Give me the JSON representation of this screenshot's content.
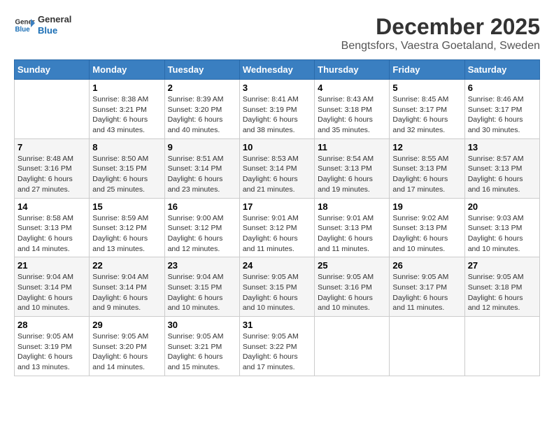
{
  "logo": {
    "line1": "General",
    "line2": "Blue"
  },
  "title": "December 2025",
  "location": "Bengtsfors, Vaestra Goetaland, Sweden",
  "days_header": [
    "Sunday",
    "Monday",
    "Tuesday",
    "Wednesday",
    "Thursday",
    "Friday",
    "Saturday"
  ],
  "weeks": [
    [
      {
        "day": "",
        "sunrise": "",
        "sunset": "",
        "daylight": ""
      },
      {
        "day": "1",
        "sunrise": "Sunrise: 8:38 AM",
        "sunset": "Sunset: 3:21 PM",
        "daylight": "Daylight: 6 hours and 43 minutes."
      },
      {
        "day": "2",
        "sunrise": "Sunrise: 8:39 AM",
        "sunset": "Sunset: 3:20 PM",
        "daylight": "Daylight: 6 hours and 40 minutes."
      },
      {
        "day": "3",
        "sunrise": "Sunrise: 8:41 AM",
        "sunset": "Sunset: 3:19 PM",
        "daylight": "Daylight: 6 hours and 38 minutes."
      },
      {
        "day": "4",
        "sunrise": "Sunrise: 8:43 AM",
        "sunset": "Sunset: 3:18 PM",
        "daylight": "Daylight: 6 hours and 35 minutes."
      },
      {
        "day": "5",
        "sunrise": "Sunrise: 8:45 AM",
        "sunset": "Sunset: 3:17 PM",
        "daylight": "Daylight: 6 hours and 32 minutes."
      },
      {
        "day": "6",
        "sunrise": "Sunrise: 8:46 AM",
        "sunset": "Sunset: 3:17 PM",
        "daylight": "Daylight: 6 hours and 30 minutes."
      }
    ],
    [
      {
        "day": "7",
        "sunrise": "Sunrise: 8:48 AM",
        "sunset": "Sunset: 3:16 PM",
        "daylight": "Daylight: 6 hours and 27 minutes."
      },
      {
        "day": "8",
        "sunrise": "Sunrise: 8:50 AM",
        "sunset": "Sunset: 3:15 PM",
        "daylight": "Daylight: 6 hours and 25 minutes."
      },
      {
        "day": "9",
        "sunrise": "Sunrise: 8:51 AM",
        "sunset": "Sunset: 3:14 PM",
        "daylight": "Daylight: 6 hours and 23 minutes."
      },
      {
        "day": "10",
        "sunrise": "Sunrise: 8:53 AM",
        "sunset": "Sunset: 3:14 PM",
        "daylight": "Daylight: 6 hours and 21 minutes."
      },
      {
        "day": "11",
        "sunrise": "Sunrise: 8:54 AM",
        "sunset": "Sunset: 3:13 PM",
        "daylight": "Daylight: 6 hours and 19 minutes."
      },
      {
        "day": "12",
        "sunrise": "Sunrise: 8:55 AM",
        "sunset": "Sunset: 3:13 PM",
        "daylight": "Daylight: 6 hours and 17 minutes."
      },
      {
        "day": "13",
        "sunrise": "Sunrise: 8:57 AM",
        "sunset": "Sunset: 3:13 PM",
        "daylight": "Daylight: 6 hours and 16 minutes."
      }
    ],
    [
      {
        "day": "14",
        "sunrise": "Sunrise: 8:58 AM",
        "sunset": "Sunset: 3:13 PM",
        "daylight": "Daylight: 6 hours and 14 minutes."
      },
      {
        "day": "15",
        "sunrise": "Sunrise: 8:59 AM",
        "sunset": "Sunset: 3:12 PM",
        "daylight": "Daylight: 6 hours and 13 minutes."
      },
      {
        "day": "16",
        "sunrise": "Sunrise: 9:00 AM",
        "sunset": "Sunset: 3:12 PM",
        "daylight": "Daylight: 6 hours and 12 minutes."
      },
      {
        "day": "17",
        "sunrise": "Sunrise: 9:01 AM",
        "sunset": "Sunset: 3:12 PM",
        "daylight": "Daylight: 6 hours and 11 minutes."
      },
      {
        "day": "18",
        "sunrise": "Sunrise: 9:01 AM",
        "sunset": "Sunset: 3:13 PM",
        "daylight": "Daylight: 6 hours and 11 minutes."
      },
      {
        "day": "19",
        "sunrise": "Sunrise: 9:02 AM",
        "sunset": "Sunset: 3:13 PM",
        "daylight": "Daylight: 6 hours and 10 minutes."
      },
      {
        "day": "20",
        "sunrise": "Sunrise: 9:03 AM",
        "sunset": "Sunset: 3:13 PM",
        "daylight": "Daylight: 6 hours and 10 minutes."
      }
    ],
    [
      {
        "day": "21",
        "sunrise": "Sunrise: 9:04 AM",
        "sunset": "Sunset: 3:14 PM",
        "daylight": "Daylight: 6 hours and 10 minutes."
      },
      {
        "day": "22",
        "sunrise": "Sunrise: 9:04 AM",
        "sunset": "Sunset: 3:14 PM",
        "daylight": "Daylight: 6 hours and 9 minutes."
      },
      {
        "day": "23",
        "sunrise": "Sunrise: 9:04 AM",
        "sunset": "Sunset: 3:15 PM",
        "daylight": "Daylight: 6 hours and 10 minutes."
      },
      {
        "day": "24",
        "sunrise": "Sunrise: 9:05 AM",
        "sunset": "Sunset: 3:15 PM",
        "daylight": "Daylight: 6 hours and 10 minutes."
      },
      {
        "day": "25",
        "sunrise": "Sunrise: 9:05 AM",
        "sunset": "Sunset: 3:16 PM",
        "daylight": "Daylight: 6 hours and 10 minutes."
      },
      {
        "day": "26",
        "sunrise": "Sunrise: 9:05 AM",
        "sunset": "Sunset: 3:17 PM",
        "daylight": "Daylight: 6 hours and 11 minutes."
      },
      {
        "day": "27",
        "sunrise": "Sunrise: 9:05 AM",
        "sunset": "Sunset: 3:18 PM",
        "daylight": "Daylight: 6 hours and 12 minutes."
      }
    ],
    [
      {
        "day": "28",
        "sunrise": "Sunrise: 9:05 AM",
        "sunset": "Sunset: 3:19 PM",
        "daylight": "Daylight: 6 hours and 13 minutes."
      },
      {
        "day": "29",
        "sunrise": "Sunrise: 9:05 AM",
        "sunset": "Sunset: 3:20 PM",
        "daylight": "Daylight: 6 hours and 14 minutes."
      },
      {
        "day": "30",
        "sunrise": "Sunrise: 9:05 AM",
        "sunset": "Sunset: 3:21 PM",
        "daylight": "Daylight: 6 hours and 15 minutes."
      },
      {
        "day": "31",
        "sunrise": "Sunrise: 9:05 AM",
        "sunset": "Sunset: 3:22 PM",
        "daylight": "Daylight: 6 hours and 17 minutes."
      },
      {
        "day": "",
        "sunrise": "",
        "sunset": "",
        "daylight": ""
      },
      {
        "day": "",
        "sunrise": "",
        "sunset": "",
        "daylight": ""
      },
      {
        "day": "",
        "sunrise": "",
        "sunset": "",
        "daylight": ""
      }
    ]
  ]
}
